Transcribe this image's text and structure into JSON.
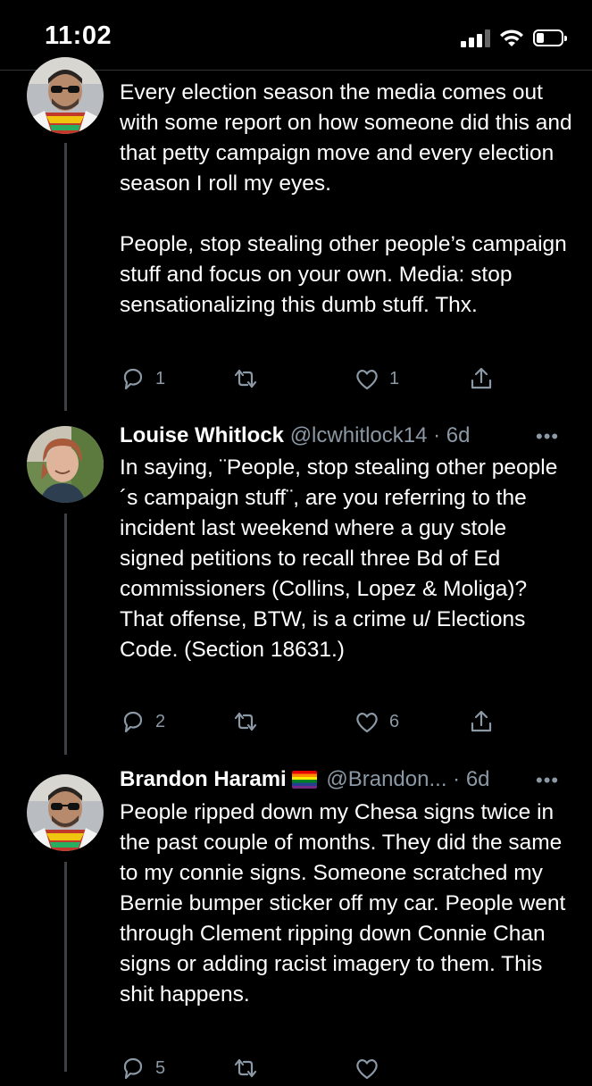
{
  "status": {
    "time": "11:02"
  },
  "tweets": [
    {
      "text": "Every election season the media comes out with some report on how someone did this and that petty campaign move and every election season I roll my eyes.\n\nPeople, stop stealing other people’s campaign stuff and focus on your own. Media: stop sensationalizing this dumb stuff. Thx.",
      "replies": "1",
      "likes": "1"
    },
    {
      "name": "Louise Whitlock",
      "handle": "@lcwhitlock14",
      "time": "· 6d",
      "text": "In saying, ¨People, stop stealing other people´s campaign stuff¨, are you referring to the incident last weekend where a guy stole signed petitions to recall three Bd of Ed commissioners (Collins, Lopez & Moliga)? That offense, BTW, is a crime u/ Elections Code. (Section 18631.)",
      "replies": "2",
      "likes": "6"
    },
    {
      "name": "Brandon Harami",
      "handle": "@Brandon...",
      "time": "· 6d",
      "text": "People ripped down my Chesa signs twice in the past couple of months. They did the same to my connie signs. Someone scratched my Bernie bumper sticker off my car. People went through Clement ripping down Connie Chan signs or adding racist imagery to them. This shit happens.",
      "replies": "5"
    }
  ],
  "icons": [
    "signal-icon",
    "wifi-icon",
    "battery-icon",
    "reply-icon",
    "retweet-icon",
    "like-icon",
    "share-icon",
    "more-icon",
    "rainbow-flag-icon"
  ],
  "colors": {
    "background": "#000000",
    "text": "#ffffff",
    "secondary": "#8b98a5",
    "thread_line": "#3d4146"
  }
}
